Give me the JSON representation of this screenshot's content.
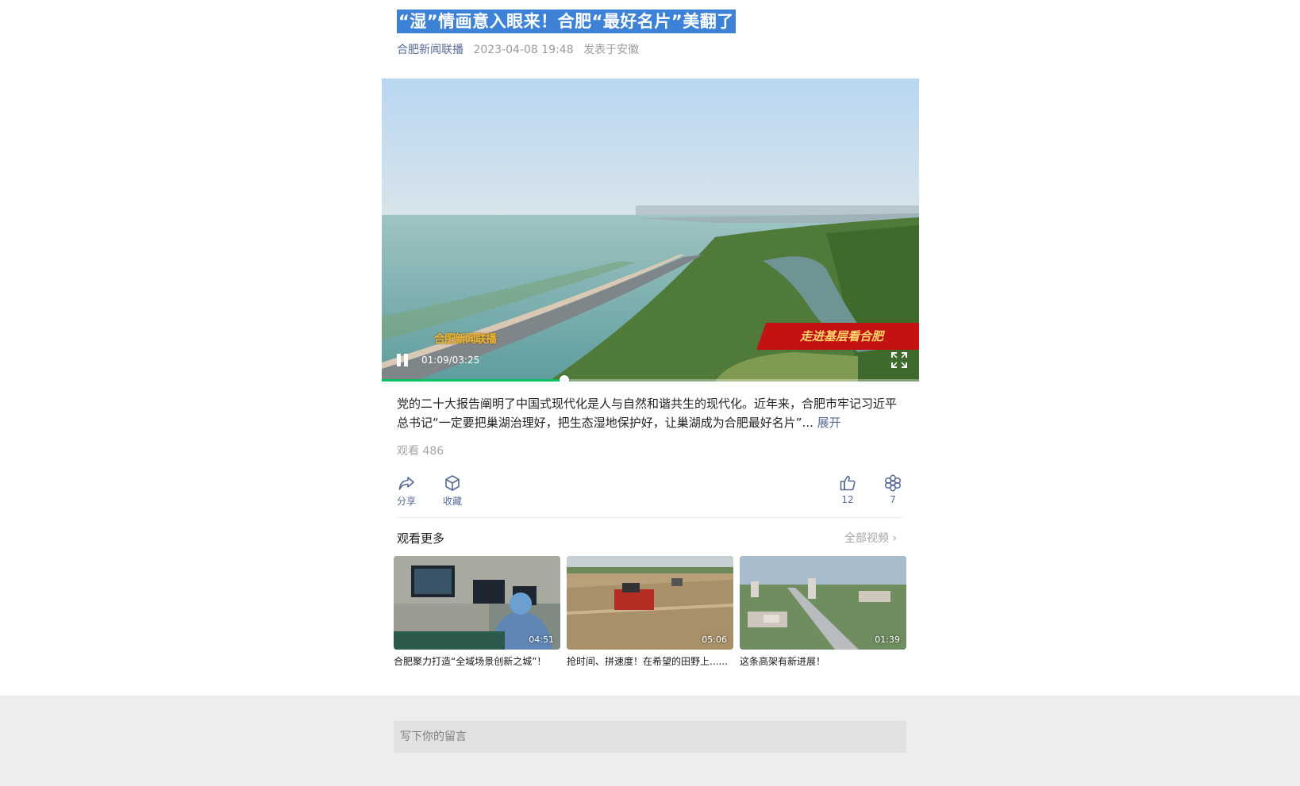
{
  "article": {
    "title": "“湿”情画意入眼来！合肥“最好名片”美翻了",
    "account": "合肥新闻联播",
    "date": "2023-04-08 19:48",
    "location": "发表于安徽"
  },
  "video": {
    "current_time": "01:09",
    "duration": "03:25",
    "time_display": "01:09/03:25",
    "progress": 0.34,
    "banner_text": "走进基层看合肥",
    "logo_text": "合肥新闻联播",
    "pause_icon": "pause-icon",
    "fullscreen_icon": "fullscreen-icon",
    "progress_color": "#07c160"
  },
  "description": {
    "text": "党的二十大报告阐明了中国式现代化是人与自然和谐共生的现代化。近年来，合肥市牢记习近平总书记“一定要把巢湖治理好，把生态湿地保护好，让巢湖成为合肥最好名片”...",
    "expand_label": "展开"
  },
  "views": "观看 486",
  "actions": {
    "share": {
      "label": "分享",
      "icon": "share-icon"
    },
    "favorite": {
      "label": "收藏",
      "icon": "favorite-box-icon"
    },
    "like": {
      "count": "12",
      "icon": "thumb-up-icon"
    },
    "wow": {
      "count": "7",
      "icon": "flower-icon"
    }
  },
  "more": {
    "title": "观看更多",
    "all_label": "全部视频 ›",
    "items": [
      {
        "duration": "04:51",
        "caption": "合肥聚力打造“全域场景创新之城”！"
      },
      {
        "duration": "05:06",
        "caption": "抢时间、拼速度！在希望的田野上......"
      },
      {
        "duration": "01:39",
        "caption": "这条高架有新进展！"
      }
    ]
  },
  "comment": {
    "placeholder": "写下你的留言"
  },
  "colors": {
    "link": "#576b95",
    "title_highlight": "#3d82d6",
    "footer_bg": "#ededed"
  }
}
